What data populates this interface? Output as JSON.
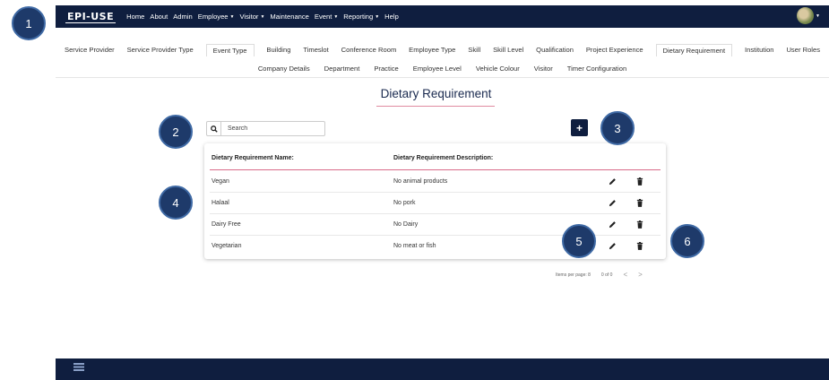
{
  "navbar": {
    "logo": "EPI-USE",
    "items": [
      {
        "label": "Home",
        "caret": false
      },
      {
        "label": "About",
        "caret": false
      },
      {
        "label": "Admin",
        "caret": false
      },
      {
        "label": "Employee",
        "caret": true
      },
      {
        "label": "Visitor",
        "caret": true
      },
      {
        "label": "Maintenance",
        "caret": false
      },
      {
        "label": "Event",
        "caret": true
      },
      {
        "label": "Reporting",
        "caret": true
      },
      {
        "label": "Help",
        "caret": false
      }
    ]
  },
  "tabs": {
    "row1": [
      "Service Provider",
      "Service Provider Type",
      "Event Type",
      "Building",
      "Timeslot",
      "Conference Room",
      "Employee Type",
      "Skill",
      "Skill Level",
      "Qualification",
      "Project Experience",
      "Dietary Requirement",
      "Institution",
      "User Roles"
    ],
    "row2": [
      "Company Details",
      "Department",
      "Practice",
      "Employee Level",
      "Vehicle Colour",
      "Visitor",
      "Timer Configuration"
    ],
    "active": [
      "Event Type",
      "Dietary Requirement"
    ]
  },
  "page": {
    "title": "Dietary Requirement"
  },
  "search": {
    "placeholder": "Search",
    "value": ""
  },
  "add_button": {
    "label": "+"
  },
  "table": {
    "headers": [
      "Dietary Requirement Name:",
      "Dietary Requirement Description:"
    ],
    "rows": [
      {
        "name": "Vegan",
        "description": "No animal products"
      },
      {
        "name": "Halaal",
        "description": "No pork"
      },
      {
        "name": "Dairy Free",
        "description": "No Dairy"
      },
      {
        "name": "Vegetarian",
        "description": "No meat or fish"
      }
    ]
  },
  "paginator": {
    "items_per_page": "Items per page: 8",
    "range": "0 of 0",
    "prev": "<",
    "next": ">"
  },
  "callouts": [
    "1",
    "2",
    "3",
    "4",
    "5",
    "6"
  ],
  "colors": {
    "navbar": "#0f1e3f",
    "accent_line": "#d96b89",
    "callout": "#1e3a6a"
  }
}
